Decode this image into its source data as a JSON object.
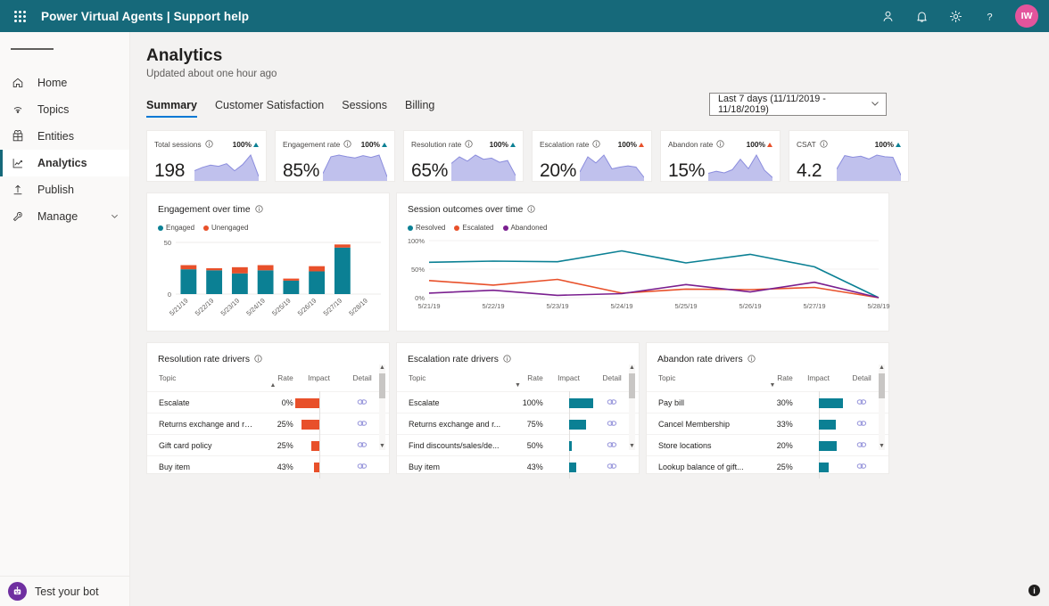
{
  "topbar": {
    "waffle_label": "app-launcher",
    "title": "Power Virtual Agents | Support help",
    "icons": [
      "person-icon",
      "bell-icon",
      "gear-icon",
      "help-icon"
    ],
    "avatar_initials": "IW",
    "avatar_color": "#e3549c",
    "bg_color": "#16697a"
  },
  "sidebar": {
    "menu_label": "menu",
    "items": [
      {
        "label": "Home",
        "icon": "home-icon",
        "active": false
      },
      {
        "label": "Topics",
        "icon": "topics-icon",
        "active": false
      },
      {
        "label": "Entities",
        "icon": "entities-icon",
        "active": false
      },
      {
        "label": "Analytics",
        "icon": "analytics-icon",
        "active": true
      },
      {
        "label": "Publish",
        "icon": "publish-icon",
        "active": false
      },
      {
        "label": "Manage",
        "icon": "manage-icon",
        "active": false,
        "expandable": true
      }
    ],
    "test_bot": {
      "label": "Test your bot",
      "icon": "bot-icon",
      "color": "#6f2fa0"
    }
  },
  "header": {
    "title": "Analytics",
    "subtitle": "Updated about one hour ago"
  },
  "tabs": [
    {
      "label": "Summary",
      "active": true
    },
    {
      "label": "Customer Satisfaction",
      "active": false
    },
    {
      "label": "Sessions",
      "active": false
    },
    {
      "label": "Billing",
      "active": false
    }
  ],
  "date_range": {
    "value": "Last 7 days (11/11/2019 - 11/18/2019)",
    "chevron": "chevron-down-icon"
  },
  "kpis": [
    {
      "label": "Total sessions",
      "value": "198",
      "delta": "100%",
      "trend": "up",
      "trend_good": true
    },
    {
      "label": "Engagement rate",
      "value": "85%",
      "delta": "100%",
      "trend": "up",
      "trend_good": true
    },
    {
      "label": "Resolution rate",
      "value": "65%",
      "delta": "100%",
      "trend": "up",
      "trend_good": true
    },
    {
      "label": "Escalation rate",
      "value": "20%",
      "delta": "100%",
      "trend": "up",
      "trend_good": false
    },
    {
      "label": "Abandon rate",
      "value": "15%",
      "delta": "100%",
      "trend": "up",
      "trend_good": false
    },
    {
      "label": "CSAT",
      "value": "4.2",
      "delta": "100%",
      "trend": "up",
      "trend_good": true
    }
  ],
  "kpi_sparklines": [
    {
      "name": "Total sessions",
      "points": [
        30,
        42,
        50,
        46,
        55,
        30,
        52,
        86,
        10
      ]
    },
    {
      "name": "Engagement rate",
      "points": [
        20,
        78,
        84,
        78,
        74,
        82,
        76,
        84,
        8
      ]
    },
    {
      "name": "Resolution rate",
      "points": [
        52,
        74,
        60,
        80,
        66,
        70,
        56,
        62,
        12
      ]
    },
    {
      "name": "Escalation rate",
      "points": [
        24,
        74,
        54,
        80,
        34,
        40,
        44,
        40,
        6
      ]
    },
    {
      "name": "Abandon rate",
      "points": [
        22,
        30,
        24,
        36,
        76,
        40,
        92,
        34,
        6
      ]
    },
    {
      "name": "CSAT",
      "points": [
        36,
        84,
        78,
        82,
        72,
        86,
        80,
        78,
        14
      ]
    }
  ],
  "cards": {
    "engagement": {
      "title": "Engagement over time",
      "info": "info-icon"
    },
    "outcomes": {
      "title": "Session outcomes over time",
      "info": "info-icon"
    }
  },
  "chart_data": [
    {
      "id": "engagement-over-time",
      "type": "bar",
      "stacked": true,
      "title": "Engagement over time",
      "categories": [
        "5/21/19",
        "5/22/19",
        "5/23/19",
        "5/24/19",
        "5/25/19",
        "5/26/19",
        "5/27/19",
        "5/28/19"
      ],
      "series": [
        {
          "name": "Engaged",
          "color": "#0b8094",
          "values": [
            24,
            23,
            20,
            23,
            13,
            22,
            45,
            0
          ]
        },
        {
          "name": "Unengaged",
          "color": "#e8502a",
          "values": [
            4,
            2,
            6,
            5,
            2,
            5,
            3,
            0
          ]
        }
      ],
      "ylabel": "",
      "xlabel": "",
      "ylim": [
        0,
        50
      ],
      "yticks": [
        "0",
        "50"
      ],
      "legend_position": "top-left",
      "grid": true
    },
    {
      "id": "session-outcomes-over-time",
      "type": "line",
      "title": "Session outcomes over time",
      "categories": [
        "5/21/19",
        "5/22/19",
        "5/23/19",
        "5/24/19",
        "5/25/19",
        "5/26/19",
        "5/27/19",
        "5/28/19"
      ],
      "series": [
        {
          "name": "Resolved",
          "color": "#0b8094",
          "values": [
            62,
            64,
            63,
            82,
            61,
            76,
            54,
            0
          ]
        },
        {
          "name": "Escalated",
          "color": "#e8502a",
          "values": [
            30,
            22,
            32,
            8,
            15,
            14,
            18,
            0
          ]
        },
        {
          "name": "Abandoned",
          "color": "#7a1f8f",
          "values": [
            8,
            13,
            4,
            7,
            23,
            10,
            27,
            0
          ]
        }
      ],
      "ylabel": "",
      "xlabel": "",
      "ylim": [
        0,
        100
      ],
      "yticks": [
        "0%",
        "50%",
        "100%"
      ],
      "legend_position": "top-left",
      "grid": true
    }
  ],
  "driver_tables": [
    {
      "id": "resolution-rate-drivers",
      "title": "Resolution rate drivers",
      "info": "info-icon",
      "columns": [
        "Topic",
        "Rate",
        "Impact",
        "Detail"
      ],
      "sort_column": "Rate",
      "sort_direction": "asc",
      "bar_color": "#e8502a",
      "bar_direction": "left",
      "rows": [
        {
          "topic": "Escalate",
          "rate": "0%",
          "impact": 100,
          "detail": "detail-link-icon"
        },
        {
          "topic": "Returns exchange and re...",
          "rate": "25%",
          "impact": 72,
          "detail": "detail-link-icon"
        },
        {
          "topic": "Gift card policy",
          "rate": "25%",
          "impact": 30,
          "detail": "detail-link-icon"
        },
        {
          "topic": "Buy item",
          "rate": "43%",
          "impact": 22,
          "detail": "detail-link-icon"
        }
      ]
    },
    {
      "id": "escalation-rate-drivers",
      "title": "Escalation rate drivers",
      "info": "info-icon",
      "columns": [
        "Topic",
        "Rate",
        "Impact",
        "Detail"
      ],
      "sort_column": "Topic",
      "sort_direction": "desc",
      "bar_color": "#0b8094",
      "bar_direction": "right",
      "rows": [
        {
          "topic": "Escalate",
          "rate": "100%",
          "impact": 100,
          "detail": "detail-link-icon"
        },
        {
          "topic": "Returns exchange and r...",
          "rate": "75%",
          "impact": 72,
          "detail": "detail-link-icon"
        },
        {
          "topic": "Find discounts/sales/de...",
          "rate": "50%",
          "impact": 10,
          "detail": "detail-link-icon"
        },
        {
          "topic": "Buy item",
          "rate": "43%",
          "impact": 32,
          "detail": "detail-link-icon"
        }
      ]
    },
    {
      "id": "abandon-rate-drivers",
      "title": "Abandon rate drivers",
      "info": "info-icon",
      "columns": [
        "Topic",
        "Rate",
        "Impact",
        "Detail"
      ],
      "sort_column": "Rate",
      "sort_direction": "desc",
      "bar_color": "#0b8094",
      "bar_direction": "right",
      "rows": [
        {
          "topic": "Pay bill",
          "rate": "30%",
          "impact": 100,
          "detail": "detail-link-icon"
        },
        {
          "topic": "Cancel Membership",
          "rate": "33%",
          "impact": 72,
          "detail": "detail-link-icon"
        },
        {
          "topic": "Store locations",
          "rate": "20%",
          "impact": 74,
          "detail": "detail-link-icon"
        },
        {
          "topic": "Lookup balance of gift...",
          "rate": "25%",
          "impact": 42,
          "detail": "detail-link-icon"
        }
      ]
    }
  ],
  "help_fab": {
    "label": "i"
  }
}
